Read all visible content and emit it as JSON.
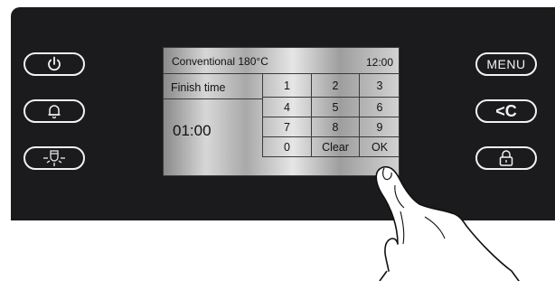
{
  "left_buttons": [
    {
      "icon": "power-icon"
    },
    {
      "icon": "bell-icon"
    },
    {
      "icon": "lamp-icon"
    }
  ],
  "right_buttons": [
    {
      "label": "MENU"
    },
    {
      "label": "<C",
      "icon": "back-clear-icon"
    },
    {
      "icon": "lock-icon"
    }
  ],
  "screen": {
    "mode_title": "Conventional 180°C",
    "clock": "12:00",
    "finish_label": "Finish time",
    "finish_value": "01:00"
  },
  "keypad": {
    "keys": [
      "1",
      "2",
      "3",
      "4",
      "5",
      "6",
      "7",
      "8",
      "9",
      "0",
      "Clear",
      "OK"
    ]
  },
  "colors": {
    "panel": "#1b1b1d",
    "button_outline": "#f2f2f2",
    "screen_metal": "#c8c8c8"
  }
}
